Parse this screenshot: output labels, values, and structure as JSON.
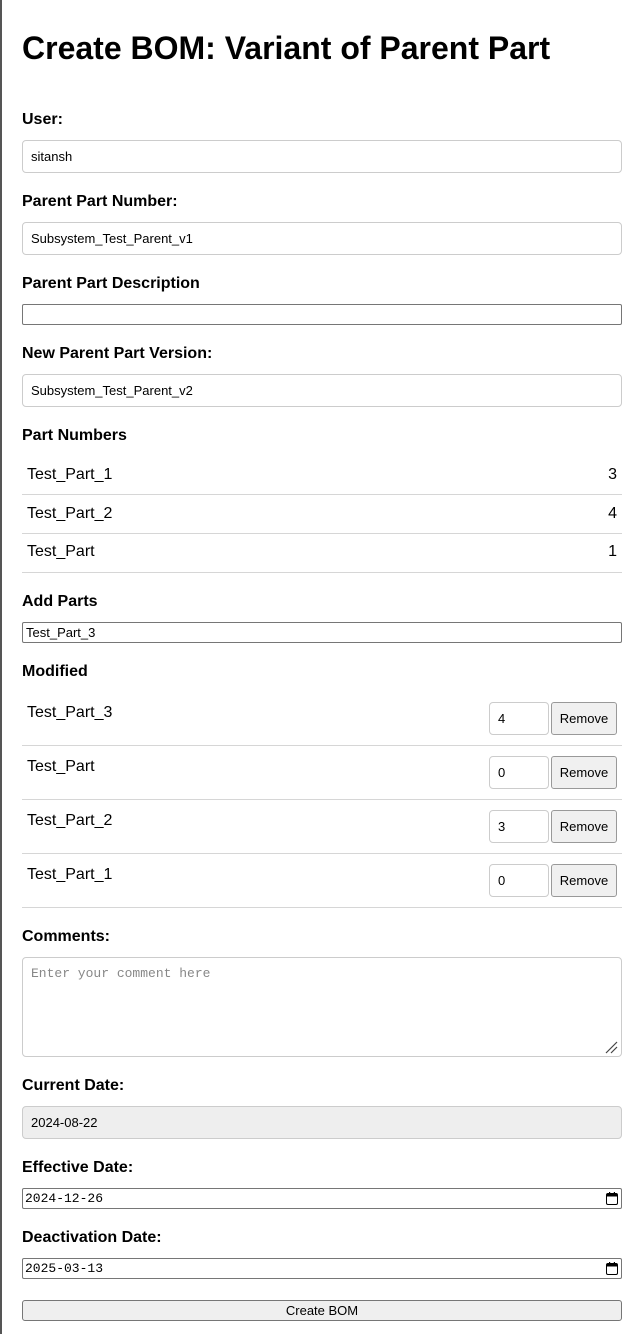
{
  "title": "Create BOM: Variant of Parent Part",
  "user": {
    "label": "User:",
    "value": "sitansh"
  },
  "parent_part_number": {
    "label": "Parent Part Number:",
    "value": "Subsystem_Test_Parent_v1"
  },
  "parent_part_description": {
    "label": "Parent Part Description",
    "value": ""
  },
  "new_parent_version": {
    "label": "New Parent Part Version:",
    "value": "Subsystem_Test_Parent_v2"
  },
  "part_numbers": {
    "label": "Part Numbers",
    "items": [
      {
        "name": "Test_Part_1",
        "qty": "3"
      },
      {
        "name": "Test_Part_2",
        "qty": "4"
      },
      {
        "name": "Test_Part",
        "qty": "1"
      }
    ]
  },
  "add_parts": {
    "label": "Add Parts",
    "value": "Test_Part_3"
  },
  "modified": {
    "label": "Modified",
    "remove_label": "Remove",
    "items": [
      {
        "name": "Test_Part_3",
        "qty": "4"
      },
      {
        "name": "Test_Part",
        "qty": "0"
      },
      {
        "name": "Test_Part_2",
        "qty": "3"
      },
      {
        "name": "Test_Part_1",
        "qty": "0"
      }
    ]
  },
  "comments": {
    "label": "Comments:",
    "placeholder": "Enter your comment here"
  },
  "current_date": {
    "label": "Current Date:",
    "value": "2024-08-22"
  },
  "effective_date": {
    "label": "Effective Date:",
    "value": "2024-12-26"
  },
  "deactivation_date": {
    "label": "Deactivation Date:",
    "value": "2025-03-13"
  },
  "submit": {
    "label": "Create BOM"
  },
  "icons": {
    "date_picker": "calendar-icon",
    "textarea_resize": "resize-grip-icon"
  }
}
